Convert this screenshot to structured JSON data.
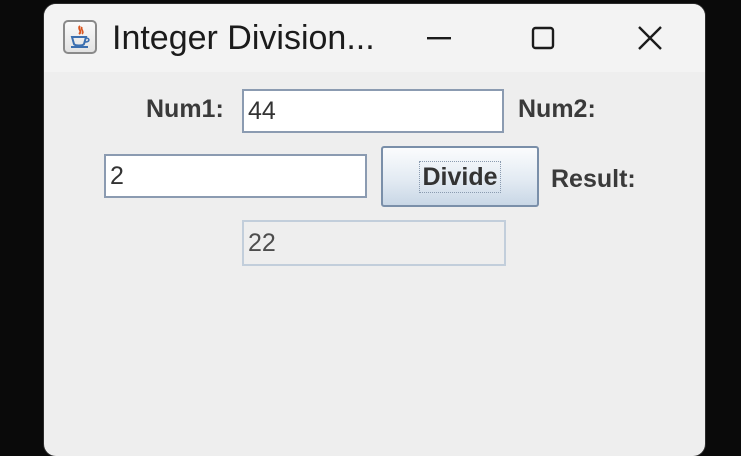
{
  "window": {
    "title": "Integer Division..."
  },
  "form": {
    "num1_label": "Num1:",
    "num1_value": "44",
    "num2_label": "Num2:",
    "num2_value": "2",
    "divide_button": "Divide",
    "result_label": "Result:",
    "result_value": "22"
  }
}
